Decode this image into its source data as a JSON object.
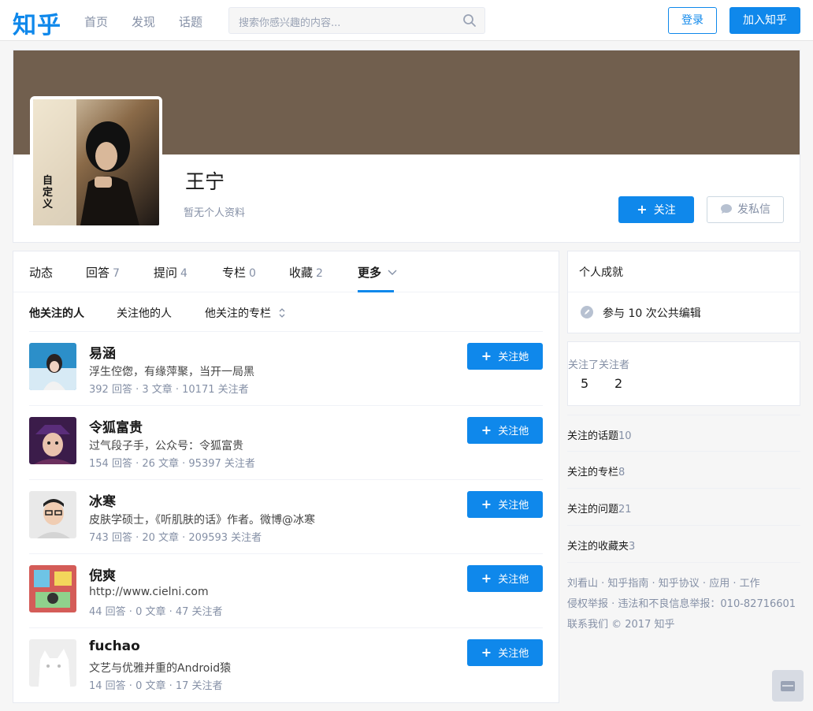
{
  "header": {
    "logo": "知乎",
    "nav": [
      "首页",
      "发现",
      "话题"
    ],
    "search_placeholder": "搜索你感兴趣的内容...",
    "login_label": "登录",
    "join_label": "加入知乎"
  },
  "profile": {
    "name": "王宁",
    "desc": "暂无个人资料",
    "follow_label": "关注",
    "message_label": "发私信",
    "cover_color": "#715f4e",
    "avatar_text": "自定义"
  },
  "tabs": [
    {
      "label": "动态",
      "count": ""
    },
    {
      "label": "回答",
      "count": "7"
    },
    {
      "label": "提问",
      "count": "4"
    },
    {
      "label": "专栏",
      "count": "0"
    },
    {
      "label": "收藏",
      "count": "2"
    },
    {
      "label": "更多",
      "count": ""
    }
  ],
  "subtabs": [
    "他关注的人",
    "关注他的人",
    "他关注的专栏"
  ],
  "people": [
    {
      "name": "易涵",
      "bio": "浮生倥偬，有缘萍聚，当开一局黑",
      "stats": "392 回答 · 3 文章 · 10171 关注者",
      "follow": "关注她"
    },
    {
      "name": "令狐富贵",
      "bio": "过气段子手，公众号：令狐富贵",
      "stats": "154 回答 · 26 文章 · 95397 关注者",
      "follow": "关注他"
    },
    {
      "name": "冰寒",
      "bio": "皮肤学硕士，《听肌肤的话》作者。微博@冰寒",
      "stats": "743 回答 · 20 文章 · 209593 关注者",
      "follow": "关注他"
    },
    {
      "name": "倪爽",
      "bio": "http://www.cielni.com",
      "stats": "44 回答 · 0 文章 · 47 关注者",
      "follow": "关注他"
    },
    {
      "name": "fuchao",
      "bio": "文艺与优雅并重的Android猿",
      "stats": "14 回答 · 0 文章 · 17 关注者",
      "follow": "关注他"
    }
  ],
  "sidebar": {
    "achievement_title": "个人成就",
    "achievement_item": "参与 10 次公共编辑",
    "follow_header": "关注了关注者",
    "following_count": "5",
    "follower_count": "2",
    "rows": [
      {
        "label": "关注的话题",
        "count": "10"
      },
      {
        "label": "关注的专栏",
        "count": "8"
      },
      {
        "label": "关注的问题",
        "count": "21"
      },
      {
        "label": "关注的收藏夹",
        "count": "3"
      }
    ],
    "footer": [
      "刘看山 · 知乎指南 · 知乎协议 · 应用 · 工作",
      "侵权举报 · 违法和不良信息举报：010-82716601",
      "联系我们 © 2017 知乎"
    ]
  }
}
